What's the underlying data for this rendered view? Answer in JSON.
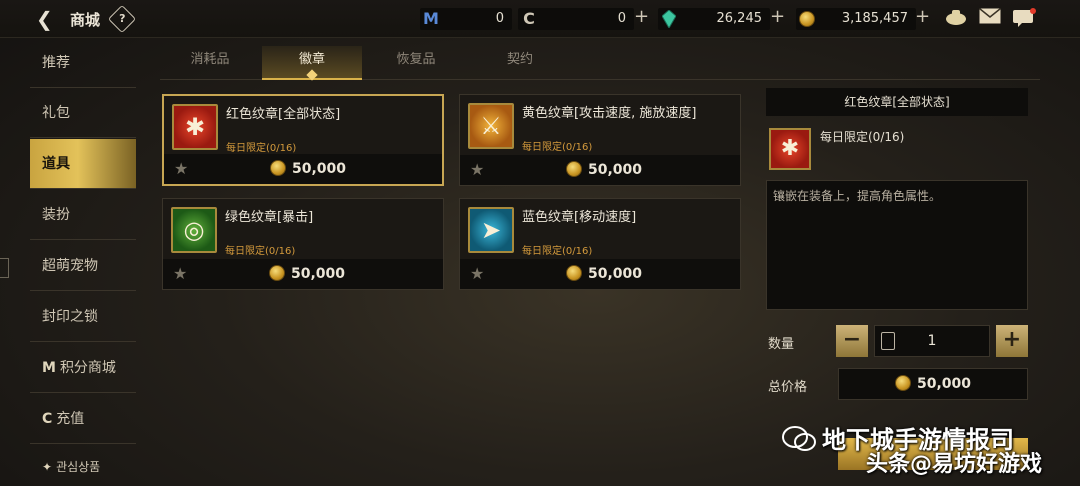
{
  "header": {
    "title": "商城",
    "help": "?",
    "currencies": [
      {
        "icon": "M",
        "value": "0"
      },
      {
        "icon": "C",
        "value": "0"
      },
      {
        "icon": "gem-icon",
        "value": "26,245"
      },
      {
        "icon": "gold-coin-icon",
        "value": "3,185,457"
      }
    ]
  },
  "sidebar": {
    "items": [
      {
        "label": "推荐"
      },
      {
        "label": "礼包"
      },
      {
        "label": "道具"
      },
      {
        "label": "装扮"
      },
      {
        "label": "超萌宠物"
      },
      {
        "label": "封印之锁"
      },
      {
        "label": "积分商城",
        "prefix": "M"
      },
      {
        "label": "充值",
        "prefix": "C"
      },
      {
        "label": "관심상품"
      }
    ],
    "active_index": 2
  },
  "tabs": [
    {
      "label": "消耗品"
    },
    {
      "label": "徽章"
    },
    {
      "label": "恢复品"
    },
    {
      "label": "契约"
    }
  ],
  "items": [
    {
      "name": "红色纹章[全部状态]",
      "limit": "每日限定(0/16)",
      "price": "50,000"
    },
    {
      "name": "黄色纹章[攻击速度, 施放速度]",
      "limit": "每日限定(0/16)",
      "price": "50,000"
    },
    {
      "name": "绿色纹章[暴击]",
      "limit": "每日限定(0/16)",
      "price": "50,000"
    },
    {
      "name": "蓝色纹章[移动速度]",
      "limit": "每日限定(0/16)",
      "price": "50,000"
    }
  ],
  "detail": {
    "title": "红色纹章[全部状态]",
    "limit": "每日限定(0/16)",
    "description": "镶嵌在装备上，提高角色属性。",
    "quantity_label": "数量",
    "quantity": "1",
    "total_label": "总价格",
    "total": "50,000"
  },
  "watermark": {
    "line1": "地下城手游情报司",
    "line2_a": "头条",
    "line2_b": "@易坊好游戏"
  },
  "colors": {
    "accent_gold": "#d9b24a",
    "limit_orange": "#d49a3c"
  }
}
